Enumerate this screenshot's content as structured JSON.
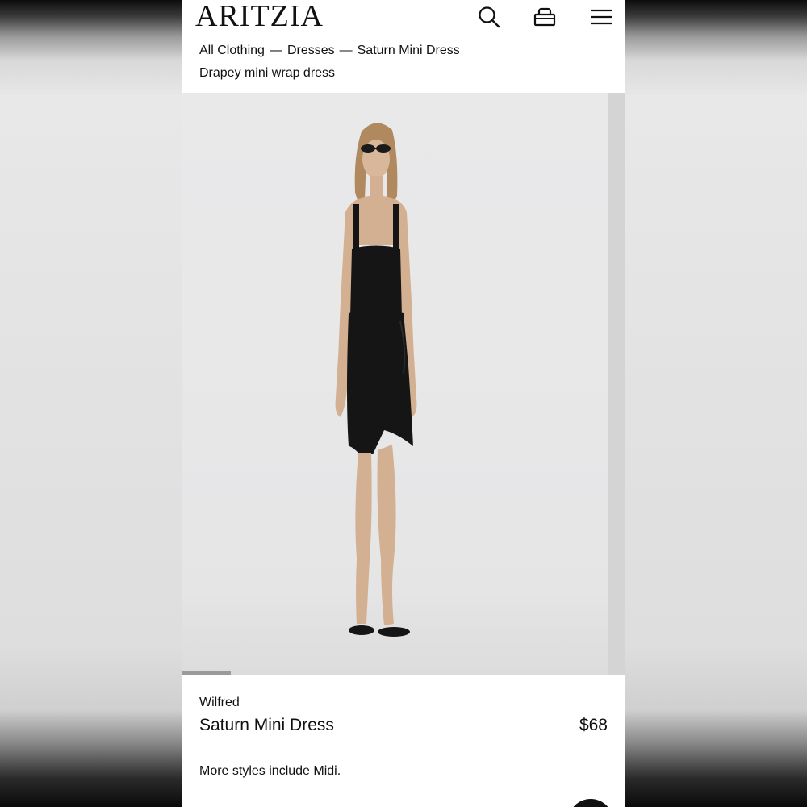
{
  "header": {
    "logo": "ARITZIA",
    "icons": [
      "search-icon",
      "bag-icon",
      "menu-icon"
    ]
  },
  "breadcrumb": {
    "items": [
      "All Clothing",
      "Dresses",
      "Saturn Mini Dress"
    ],
    "separator": "—"
  },
  "subtitle": "Drapey mini wrap dress",
  "gallery": {
    "progress": 0.11
  },
  "product": {
    "brand": "Wilfred",
    "name": "Saturn Mini Dress",
    "price": "$68",
    "more_prefix": "More styles include ",
    "more_link": "Midi",
    "more_suffix": "."
  },
  "colors": {
    "text": "#111111",
    "background": "#ffffff",
    "dress": "#151515"
  }
}
